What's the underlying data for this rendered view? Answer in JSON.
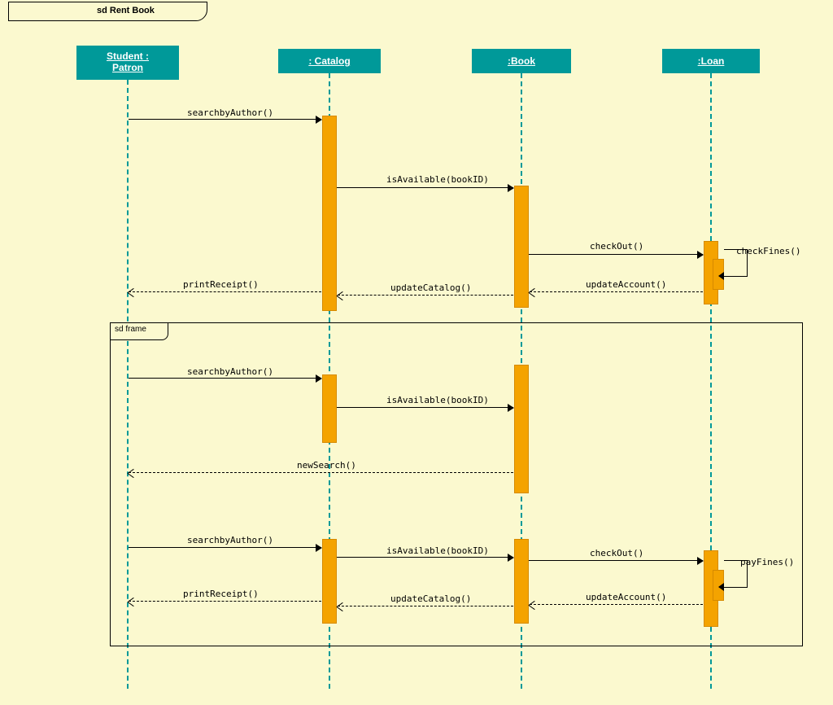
{
  "diagram": {
    "title": "sd Rent Book"
  },
  "lifelines": {
    "student": "Student :\nPatron",
    "catalog": ": Catalog",
    "book": ":Book",
    "loan": ":Loan"
  },
  "messages": {
    "m1": "searchbyAuthor()",
    "m2": "isAvailable(bookID)",
    "m3": "checkOut()",
    "m4": "checkFines()",
    "m5": "updateAccount()",
    "m6": "updateCatalog()",
    "m7": "printReceipt()",
    "m8": "searchbyAuthor()",
    "m9": "isAvailable(bookID)",
    "m10": "newSearch()",
    "m11": "searchbyAuthor()",
    "m12": "isAvailable(bookID)",
    "m13": "checkOut()",
    "m14": "payFines()",
    "m15": "updateAccount()",
    "m16": "updateCatalog()",
    "m17": "printReceipt()"
  },
  "frame": {
    "label": "sd frame"
  }
}
